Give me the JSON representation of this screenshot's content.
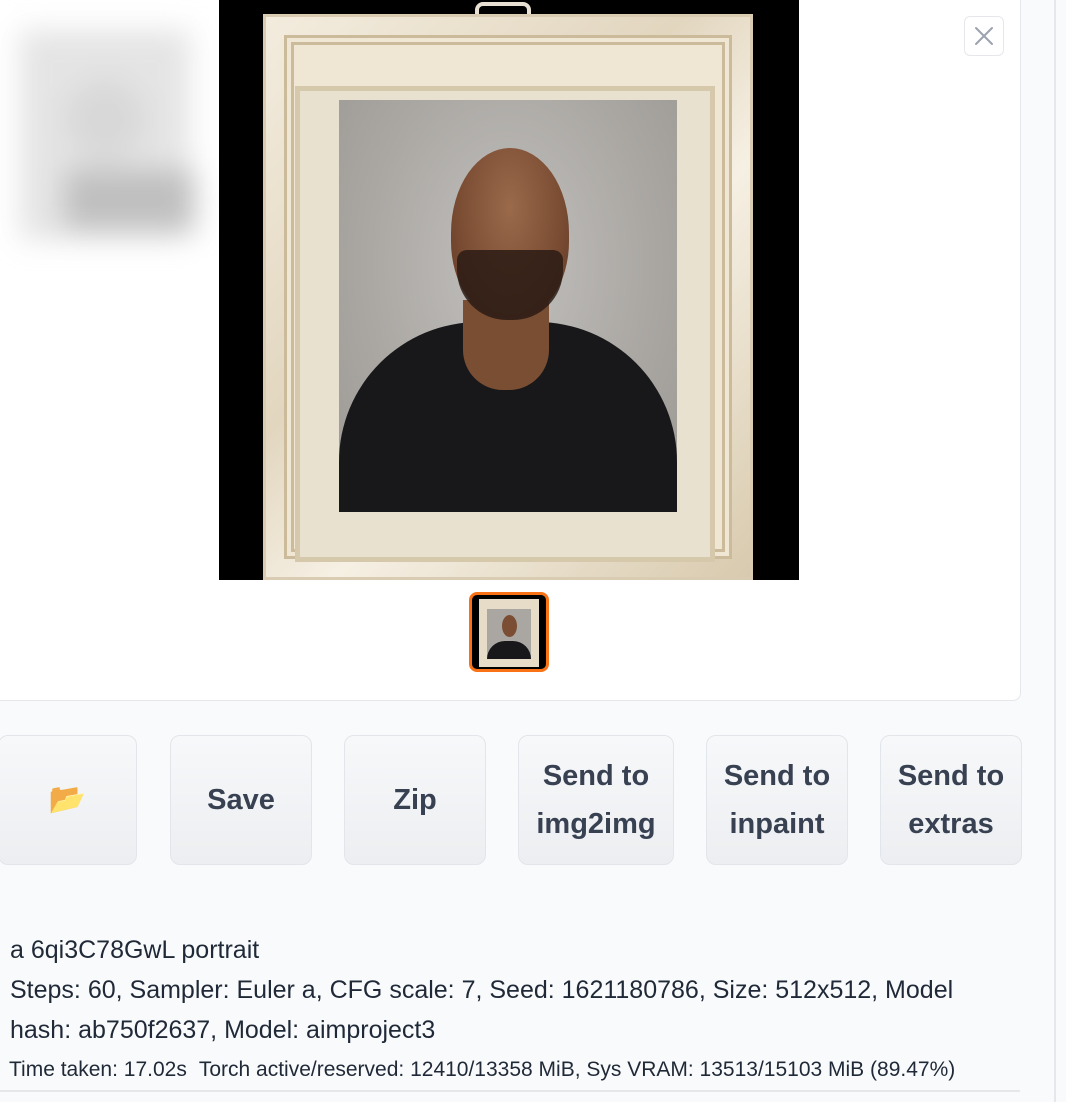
{
  "gallery": {
    "close_label": "×",
    "main_image_alt": "Generated portrait",
    "thumbnails": 1
  },
  "buttons": {
    "folder": "📂",
    "save": "Save",
    "zip": "Zip",
    "img2img": "Send to\nimg2img",
    "inpaint": "Send to\ninpaint",
    "extras": "Send to\nextras"
  },
  "generation_info": {
    "prompt": "a 6qi3C78GwL portrait",
    "params": "Steps: 60, Sampler: Euler a, CFG scale: 7, Seed: 1621180786, Size: 512x512, Model hash: ab750f2637, Model: aimproject3"
  },
  "performance": {
    "time_taken": "Time taken: 17.02s",
    "torch": "Torch active/reserved: 12410/13358 MiB, Sys VRAM: 13513/15103 MiB (89.47%)"
  },
  "colors": {
    "accent": "#f97316",
    "button_text": "#374151"
  }
}
